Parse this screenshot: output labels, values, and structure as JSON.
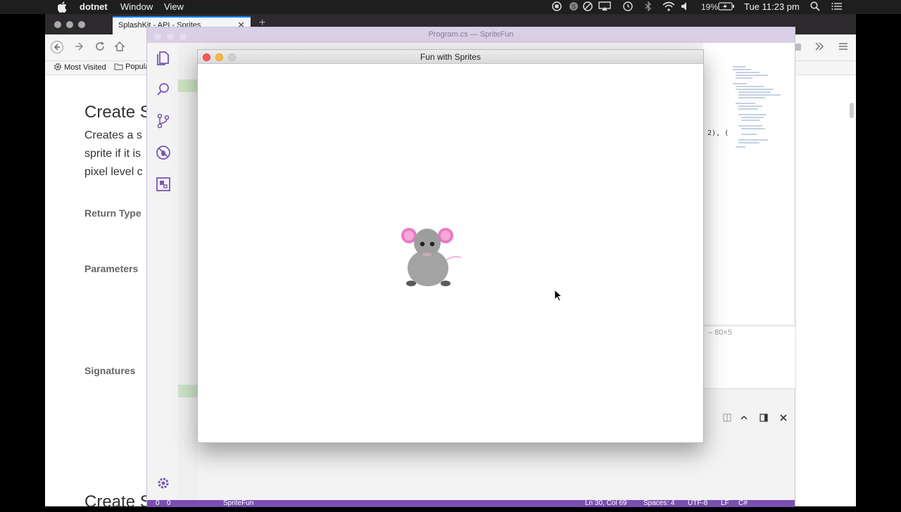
{
  "menubar": {
    "app_name": "dotnet",
    "menus": [
      "Window",
      "View"
    ],
    "battery": "19%",
    "clock": "Tue 11:23 pm"
  },
  "browser": {
    "tab_title": "SplashKit - API - Sprites",
    "bookmarks": [
      "Most Visited",
      "Popula"
    ],
    "doc": {
      "heading": "Create S",
      "para_lines": [
        "Creates a s",
        "sprite if it is",
        "pixel level c"
      ],
      "return_type_label": "Return Type",
      "parameters_label": "Parameters",
      "signatures_label": "Signatures",
      "bottom_heading": "Create S"
    }
  },
  "vscode": {
    "title": "Program.cs — SpriteFun",
    "code_fragment": "2), (",
    "terminal_title": "– 80×5",
    "status": {
      "errors": "0",
      "warnings": "0",
      "folder": "SpriteFun",
      "position": "Ln 30, Col 69",
      "spaces": "Spaces: 4",
      "encoding": "UTF-8",
      "eol": "LF",
      "language": "C#"
    }
  },
  "sprite_window": {
    "title": "Fun with Sprites"
  },
  "colors": {
    "vscode_accent": "#7a4fb0",
    "mouse_body": "#a3a3a3",
    "mouse_ear": "#e87ac4"
  }
}
